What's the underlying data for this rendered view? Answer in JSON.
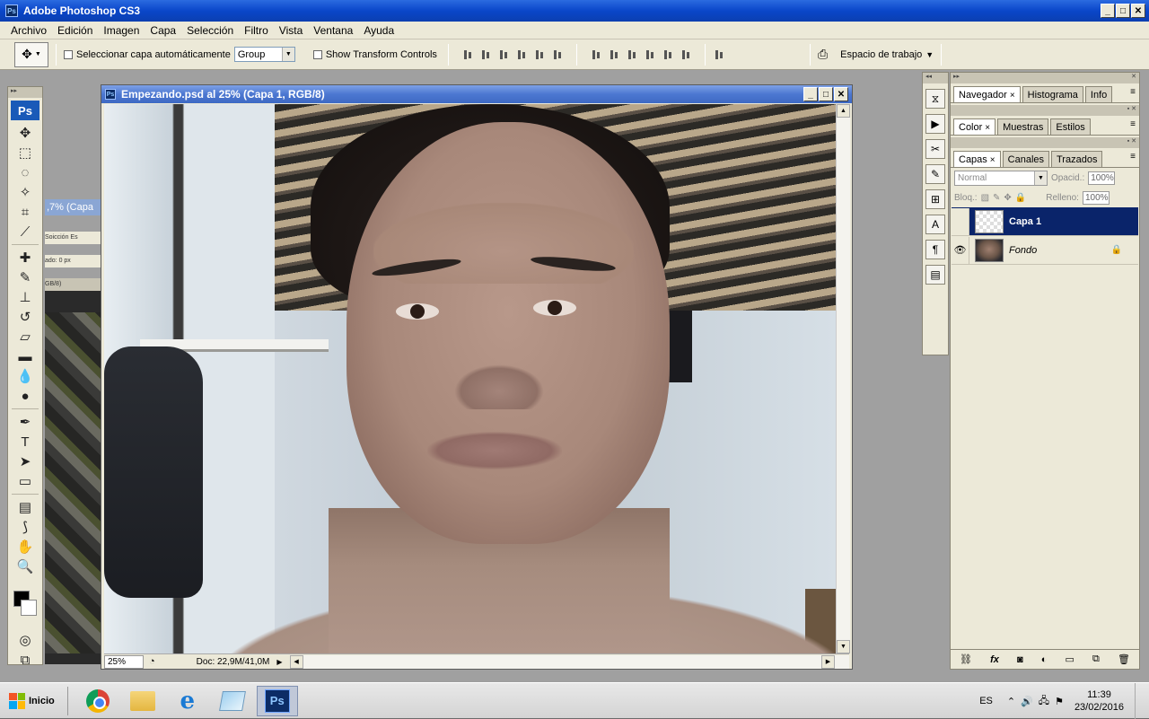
{
  "app": {
    "title": "Adobe Photoshop CS3",
    "logo": "Ps"
  },
  "menu": [
    "Archivo",
    "Edición",
    "Imagen",
    "Capa",
    "Selección",
    "Filtro",
    "Vista",
    "Ventana",
    "Ayuda"
  ],
  "options": {
    "auto_select_label": "Seleccionar capa automáticamente",
    "auto_select_value": "Group",
    "transform_label": "Show Transform Controls",
    "workspace_label": "Espacio de trabajo"
  },
  "background_doc": {
    "title_fragment": ",7% (Capa",
    "bar1": "Soicción Es",
    "bar2": "ado: 0 px",
    "bar3": "GB/8)"
  },
  "document": {
    "title": "Empezando.psd al 25% (Capa 1, RGB/8)",
    "zoom": "25%",
    "doc_info": "Doc: 22,9M/41,0M"
  },
  "panels": {
    "group1_tabs": [
      "Navegador",
      "Histograma",
      "Info"
    ],
    "group2_tabs": [
      "Color",
      "Muestras",
      "Estilos"
    ],
    "group3_tabs": [
      "Capas",
      "Canales",
      "Trazados"
    ],
    "blend_mode": "Normal",
    "opacity_label": "Opacid.:",
    "opacity_value": "100%",
    "lock_label": "Bloq.:",
    "fill_label": "Relleno:",
    "fill_value": "100%",
    "layers": [
      {
        "name": "Capa 1",
        "selected": true,
        "visible": false
      },
      {
        "name": "Fondo",
        "selected": false,
        "visible": true,
        "locked": true
      }
    ]
  },
  "taskbar": {
    "start": "Inicio",
    "apps": [
      "chrome-icon",
      "folder-icon",
      "ie-icon",
      "notepad-icon",
      "photoshop-icon"
    ],
    "language": "ES",
    "time": "11:39",
    "date": "23/02/2016",
    "ps_label": "Ps"
  },
  "colors": {
    "titlebar": "#0a46c9",
    "selected_layer": "#0a246a",
    "ps_blue": "#1a5ab8"
  }
}
